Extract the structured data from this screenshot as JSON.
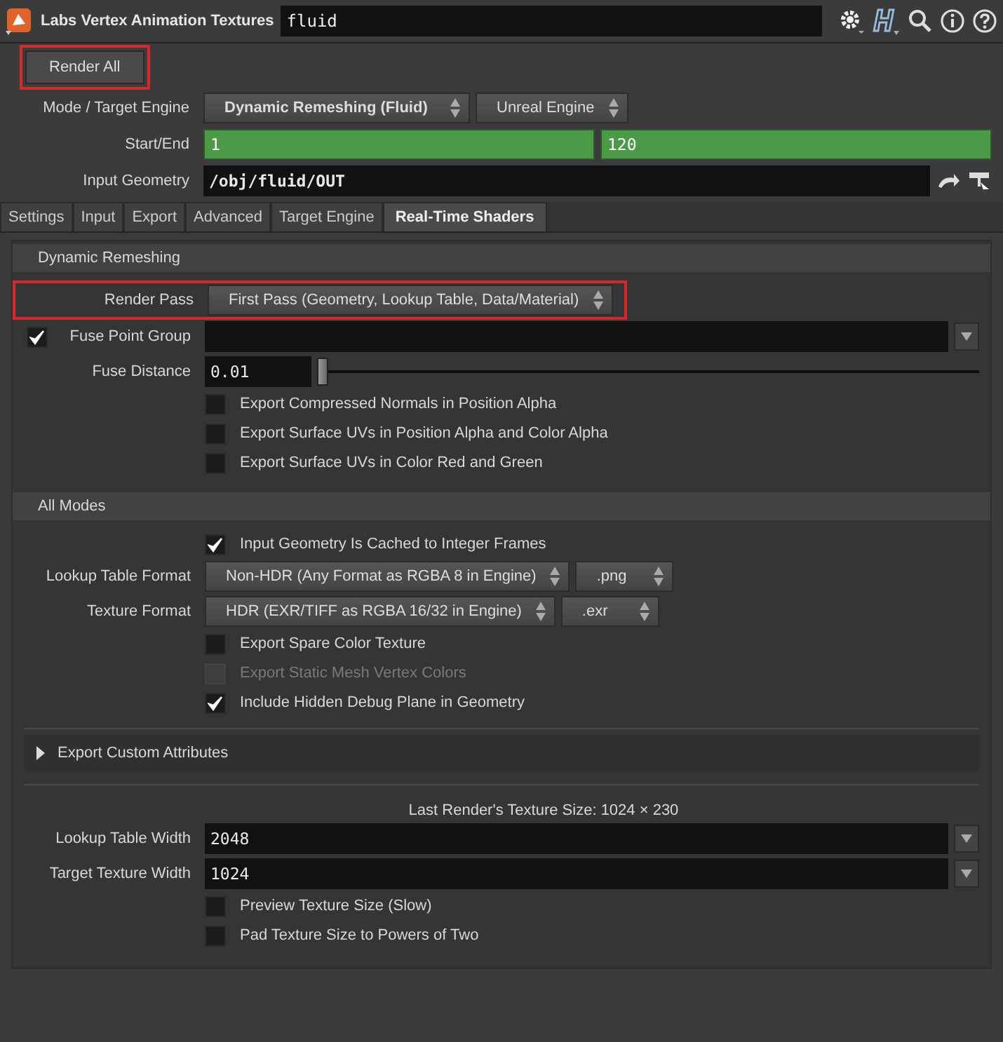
{
  "header": {
    "title": "Labs Vertex Animation Textures",
    "node_name": "fluid"
  },
  "render_button": {
    "label": "Render All",
    "highlighted": true
  },
  "top_rows": [
    {
      "kind": "menus",
      "label": "Mode / Target Engine",
      "menus": [
        {
          "text": "Dynamic Remeshing (Fluid)",
          "bold": true
        },
        {
          "text": "Unreal Engine",
          "bold": false
        }
      ]
    },
    {
      "kind": "fields",
      "label": "Start/End",
      "animated": true,
      "values": [
        "1",
        "120"
      ]
    },
    {
      "kind": "path",
      "label": "Input Geometry",
      "value": "/obj/fluid/OUT"
    }
  ],
  "tabs": [
    {
      "label": "Settings",
      "selected": false
    },
    {
      "label": "Input",
      "selected": false
    },
    {
      "label": "Export",
      "selected": false
    },
    {
      "label": "Advanced",
      "selected": false
    },
    {
      "label": "Target Engine",
      "selected": false
    },
    {
      "label": "Real-Time Shaders",
      "selected": true
    }
  ],
  "sections": [
    {
      "title": "Dynamic Remeshing",
      "rows": [
        {
          "kind": "menus",
          "label": "Render Pass",
          "highlighted": true,
          "menus": [
            {
              "text": "First Pass (Geometry, Lookup Table, Data/Material)",
              "bold": false
            }
          ]
        },
        {
          "kind": "field",
          "label": "Fuse Point Group",
          "toggle": true,
          "value": ""
        },
        {
          "kind": "slider",
          "label": "Fuse Distance",
          "value": "0.01",
          "level": 0.0
        },
        {
          "kind": "checkbox",
          "text": "Export Compressed Normals in Position Alpha",
          "checked": false,
          "disabled": false
        },
        {
          "kind": "checkbox",
          "text": "Export Surface UVs in Position Alpha and Color Alpha",
          "checked": false,
          "disabled": false
        },
        {
          "kind": "checkbox",
          "text": "Export Surface UVs in Color Red and Green",
          "checked": false,
          "disabled": false
        }
      ]
    },
    {
      "title": "All Modes",
      "rows": [
        {
          "kind": "checkbox",
          "text": "Input Geometry Is Cached to Integer Frames",
          "checked": true,
          "disabled": false
        },
        {
          "kind": "menus",
          "label": "Lookup Table Format",
          "menus": [
            {
              "text": "Non-HDR (Any Format as RGBA 8 in Engine)",
              "bold": false
            },
            {
              "text": ".png",
              "bold": false
            }
          ]
        },
        {
          "kind": "menus",
          "label": "Texture Format",
          "menus": [
            {
              "text": "HDR (EXR/TIFF as RGBA 16/32 in Engine)",
              "bold": false
            },
            {
              "text": ".exr",
              "bold": false
            }
          ]
        },
        {
          "kind": "checkbox",
          "text": "Export Spare Color Texture",
          "checked": false,
          "disabled": false
        },
        {
          "kind": "checkbox",
          "text": "Export Static Mesh Vertex Colors",
          "checked": false,
          "disabled": true
        },
        {
          "kind": "checkbox",
          "text": "Include Hidden Debug Plane in Geometry",
          "checked": true,
          "disabled": false
        },
        {
          "kind": "folder",
          "text": "Export Custom Attributes",
          "expanded": false
        },
        {
          "kind": "note",
          "text": "Last Render's Texture Size: 1024 × 230"
        },
        {
          "kind": "field",
          "label": "Lookup Table Width",
          "value": "2048"
        },
        {
          "kind": "field",
          "label": "Target Texture Width",
          "value": "1024"
        },
        {
          "kind": "checkbox",
          "text": "Preview Texture Size (Slow)",
          "checked": false,
          "disabled": false
        },
        {
          "kind": "checkbox",
          "text": "Pad Texture Size to Powers of Two",
          "checked": false,
          "disabled": false
        }
      ]
    }
  ]
}
